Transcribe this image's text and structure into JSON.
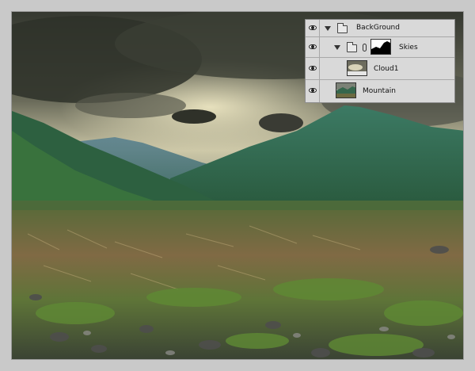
{
  "layers_panel": {
    "rows": [
      {
        "name": "BackGround",
        "type": "group",
        "expanded": true,
        "visible": true
      },
      {
        "name": "Skies",
        "type": "group-with-mask",
        "expanded": true,
        "visible": true
      },
      {
        "name": "Cloud1",
        "type": "layer",
        "visible": true
      },
      {
        "name": "Mountain",
        "type": "layer",
        "visible": true
      }
    ]
  },
  "icons": {
    "visibility": "eye-icon",
    "expand": "triangle-down-icon",
    "group": "folder-icon",
    "mask_link": "chain-link-icon"
  },
  "colors": {
    "panel_bg": "#d6d6d6",
    "frame_bg": "#c9c9c9",
    "sky_dark": "#3f4237",
    "sky_light": "#cfc8a8",
    "mountain": "#2f6a4f",
    "grass": "#6b7a3a"
  }
}
